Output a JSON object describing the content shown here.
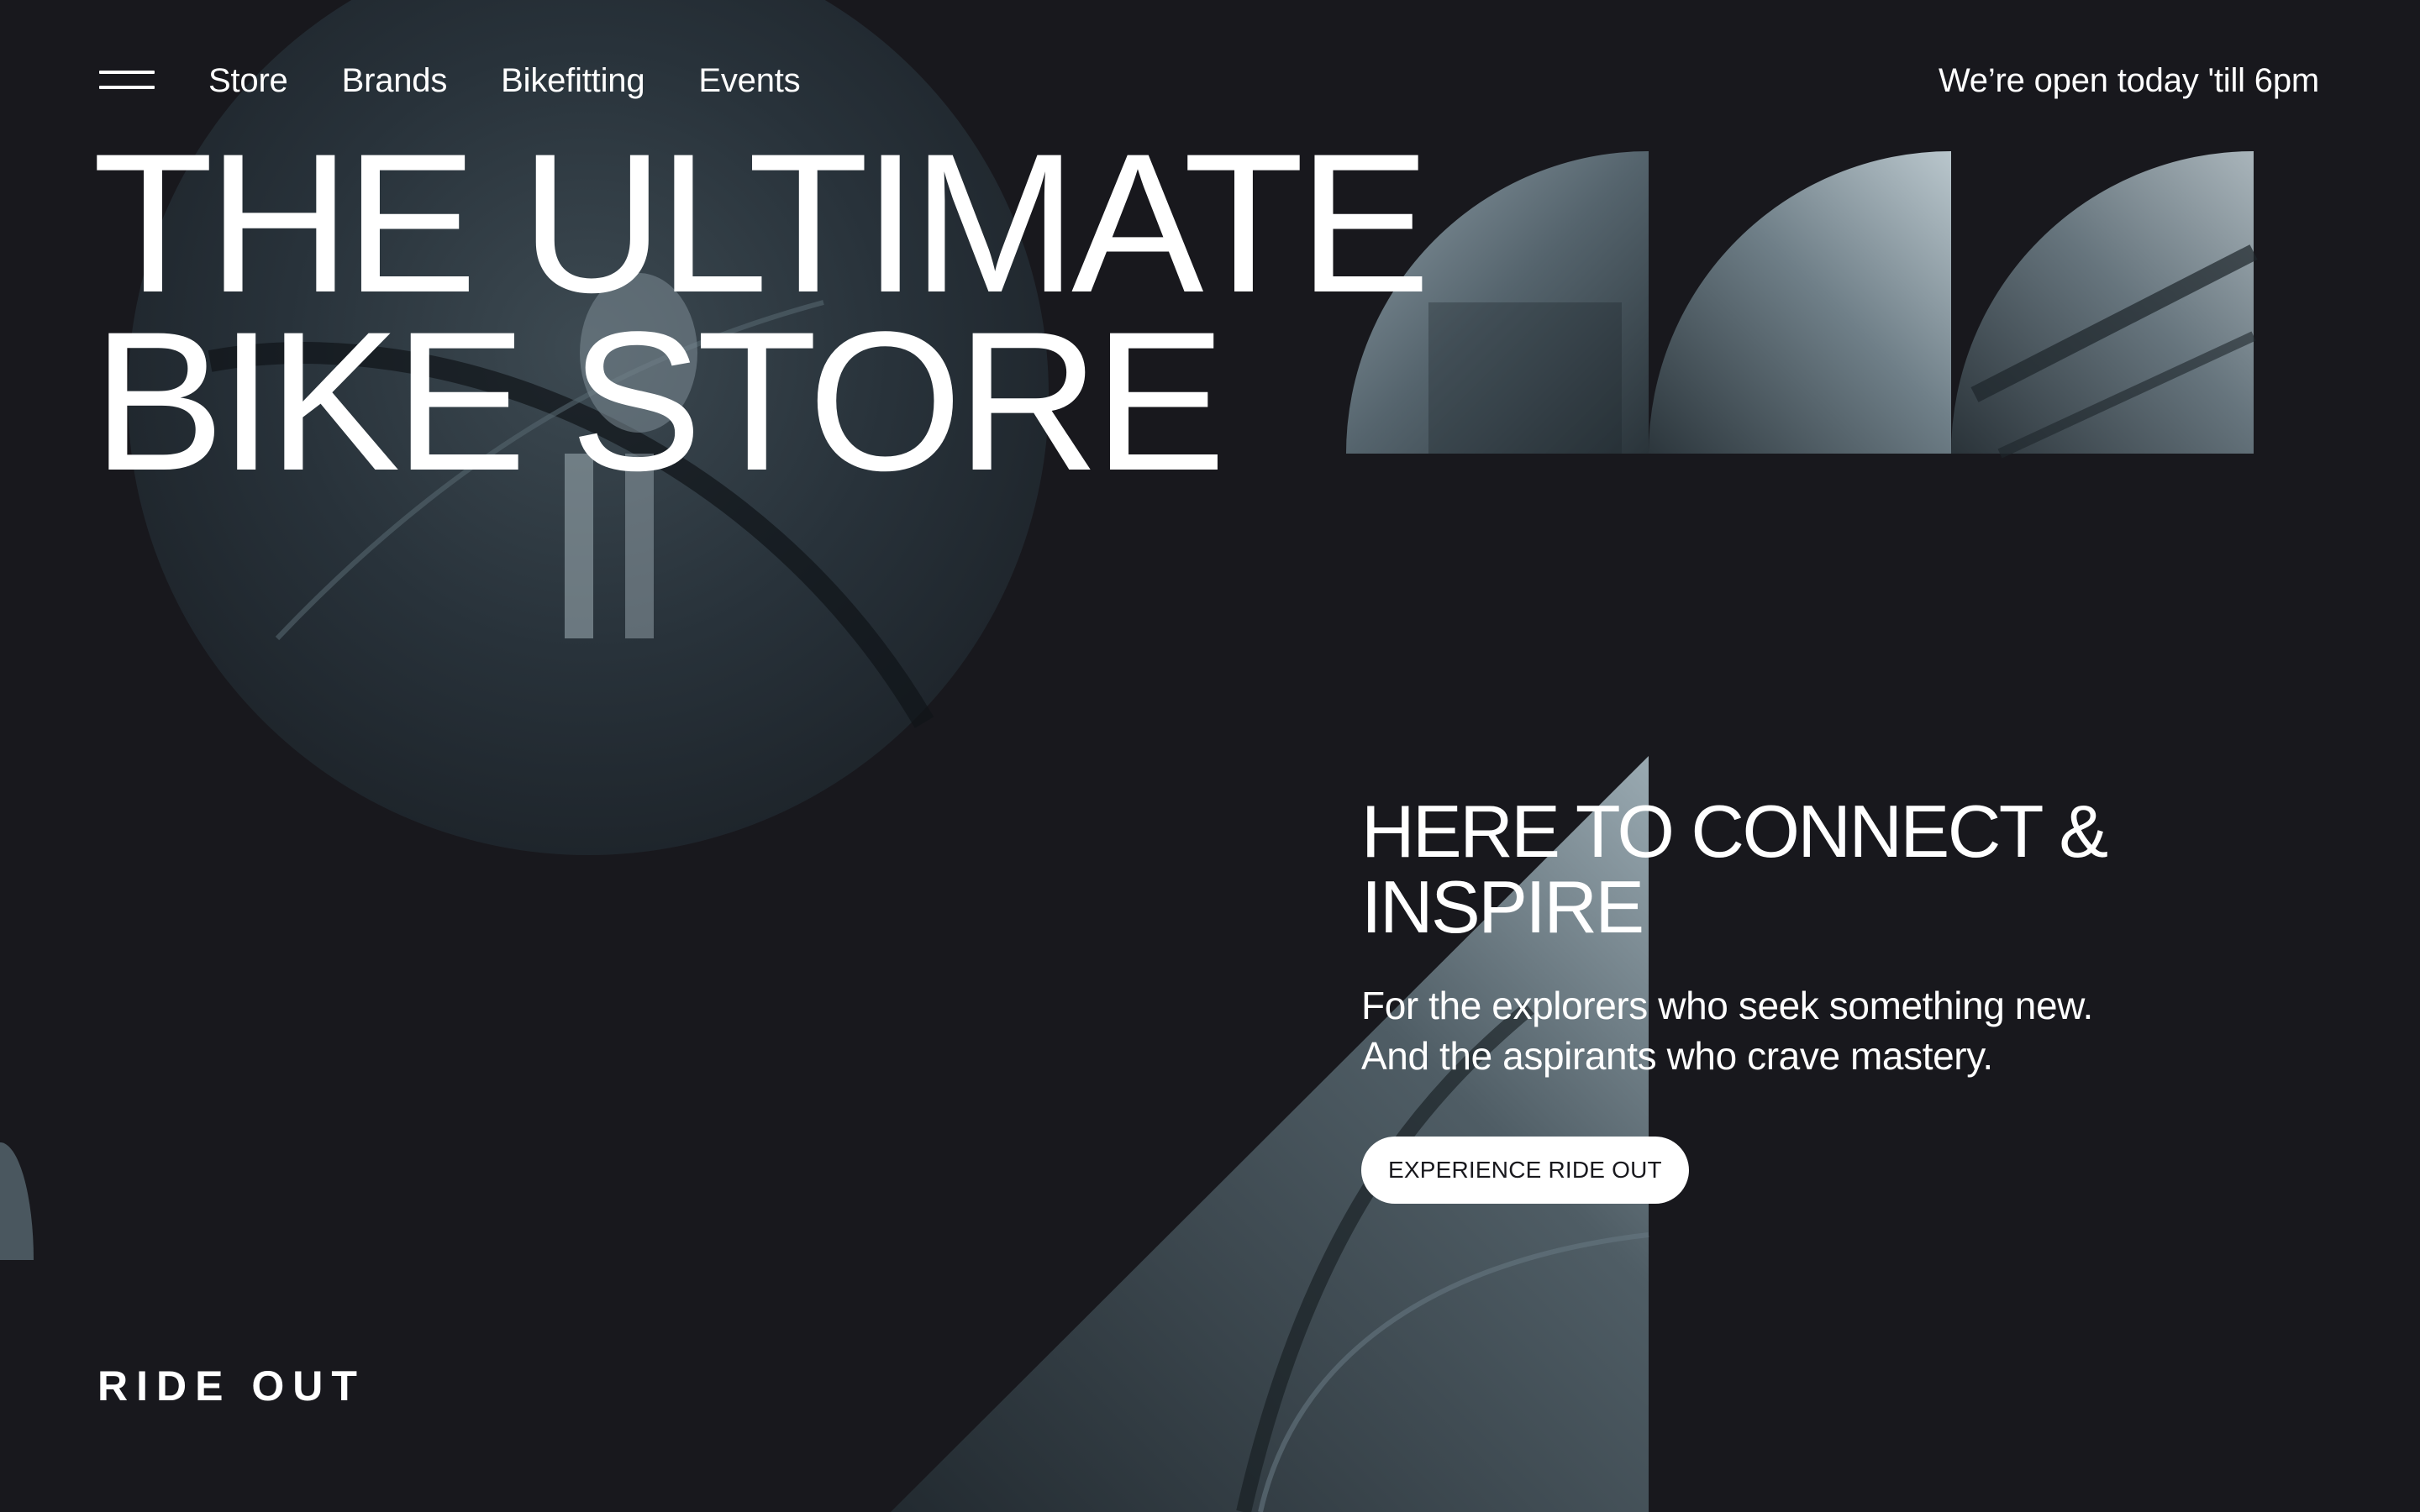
{
  "nav": {
    "items": [
      {
        "label": "Store"
      },
      {
        "label": "Brands"
      },
      {
        "label": "Bikefitting"
      },
      {
        "label": "Events"
      }
    ]
  },
  "header": {
    "hours": "We’re open today 'till 6pm"
  },
  "hero": {
    "title_line1": "THE ULTIMATE",
    "title_line2": "BIKE STORE"
  },
  "intro": {
    "heading_line1": "HERE TO CONNECT &",
    "heading_line2": "INSPIRE",
    "lead_line1": "For the explorers who seek something new.",
    "lead_line2": "And the aspirants who crave mastery.",
    "cta_label": "EXPERIENCE RIDE OUT"
  },
  "footer": {
    "brand": "RIDE OUT"
  },
  "icons": {
    "menu": "menu-icon"
  },
  "colors": {
    "background": "#18181d",
    "text": "#ffffff",
    "button_bg": "#ffffff",
    "button_text": "#18181d"
  }
}
